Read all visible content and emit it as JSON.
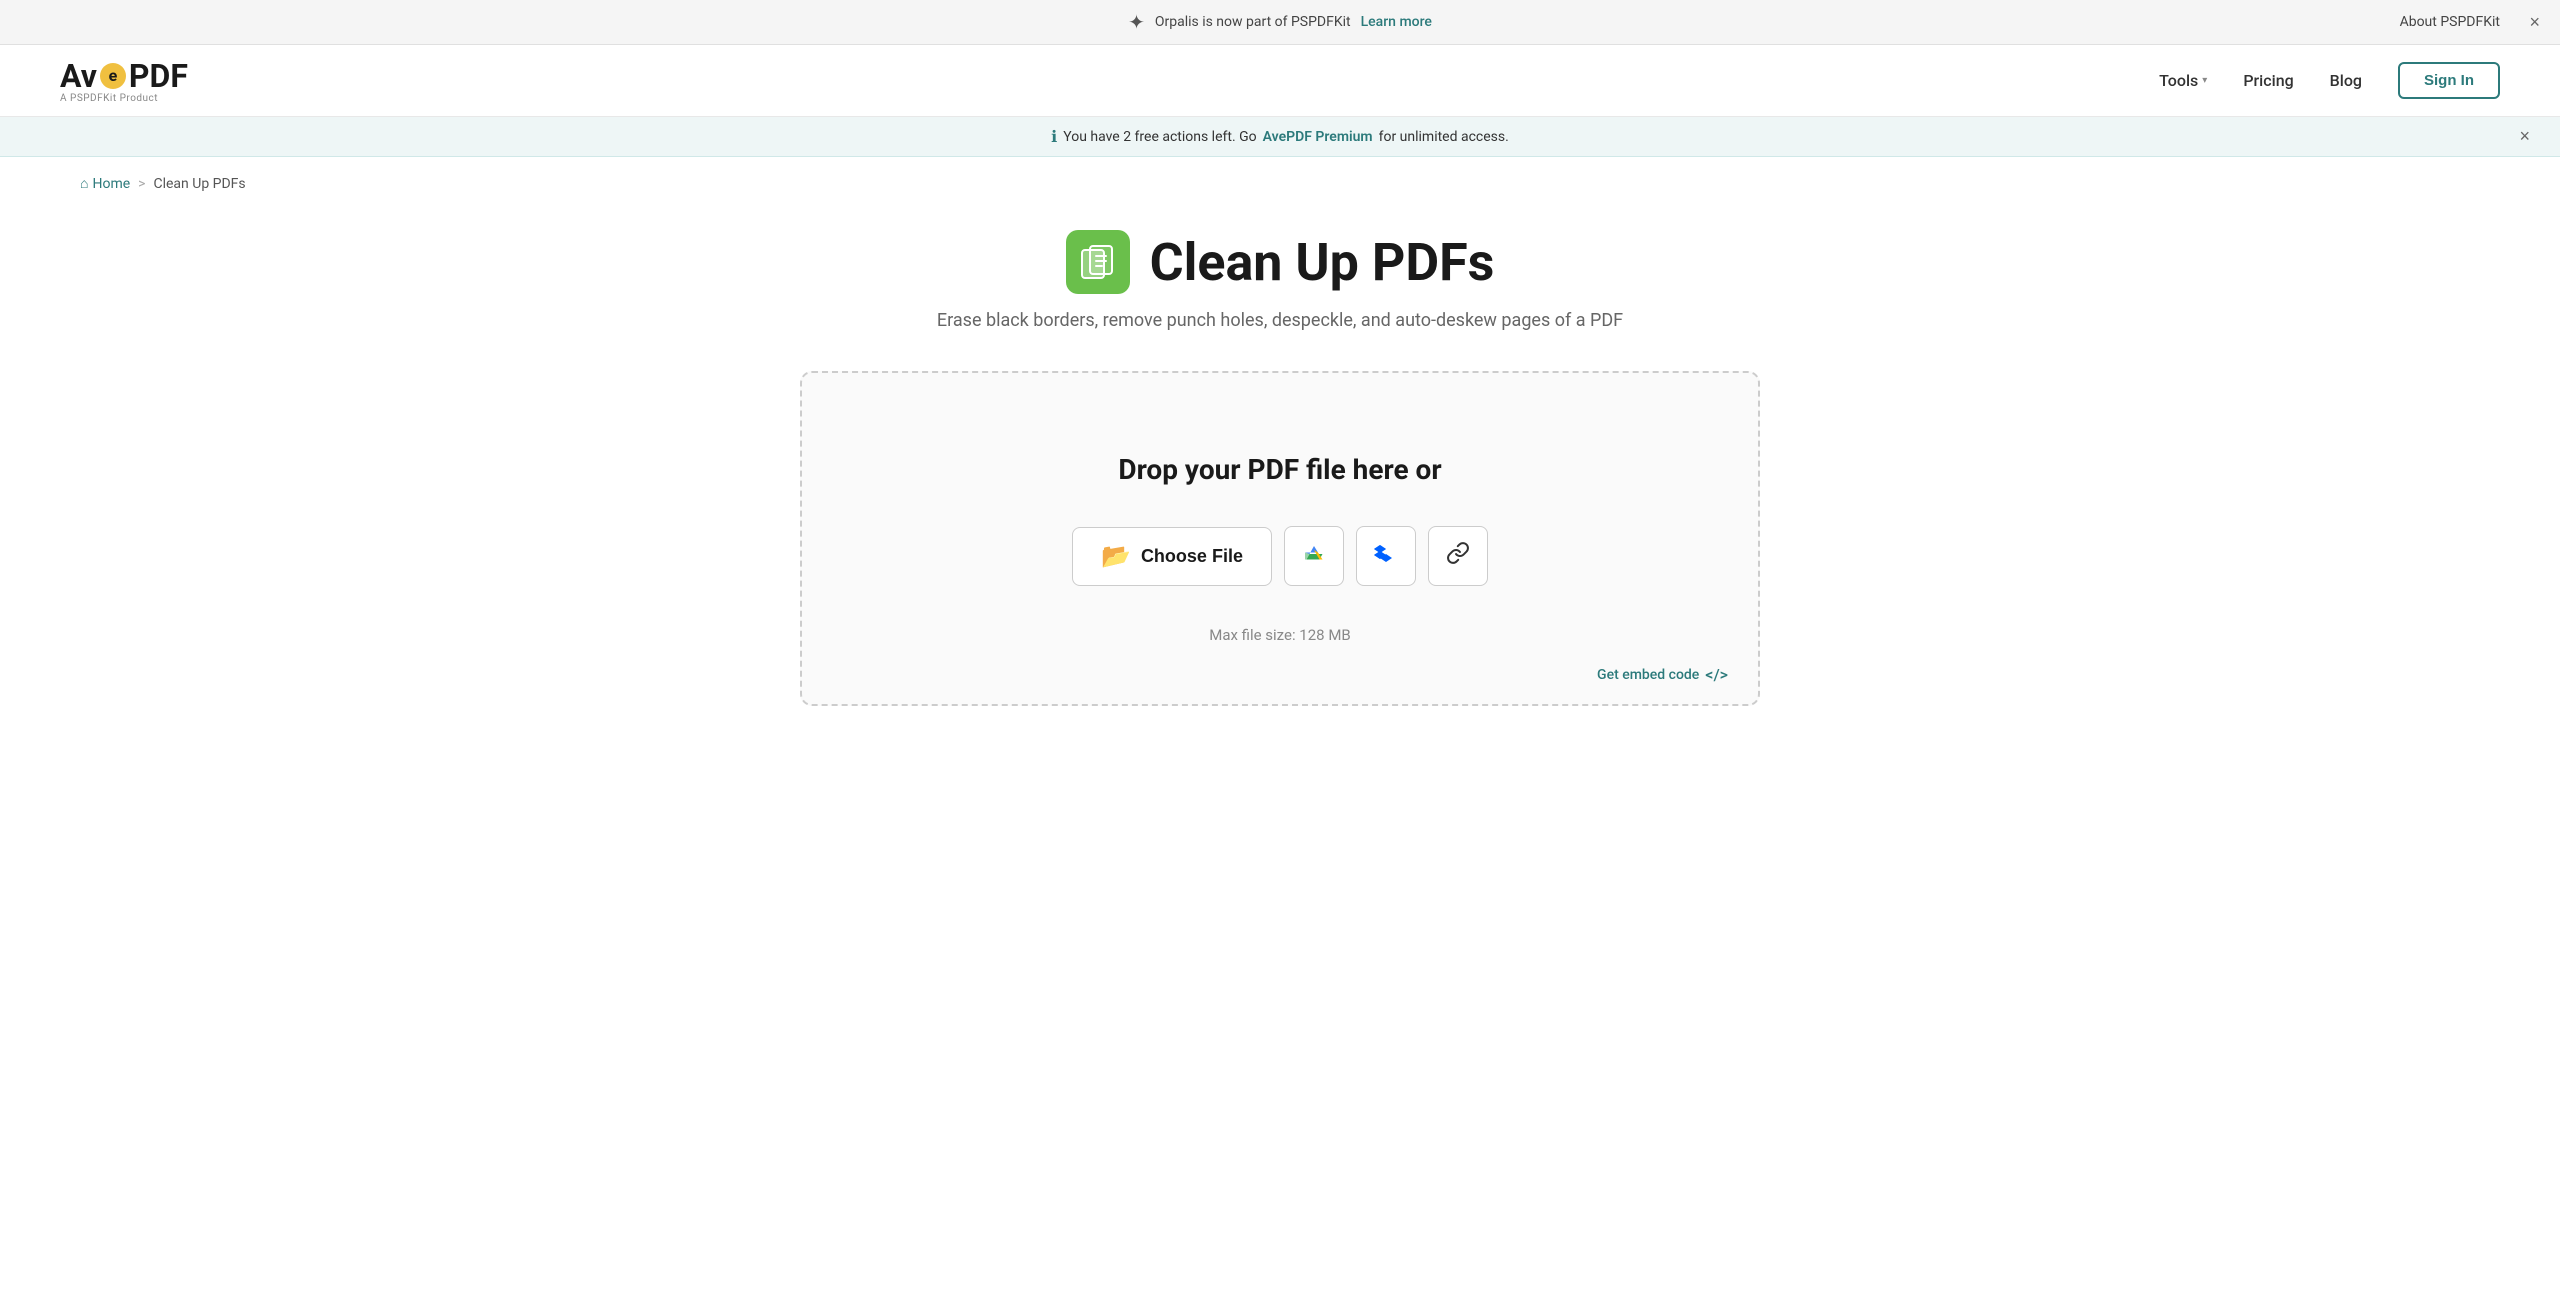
{
  "announcement": {
    "icon": "✦",
    "text": "Orpalis is now part of PSPDFKit",
    "learn_more_label": "Learn more",
    "about_label": "About PSPDFKit",
    "close_label": "×"
  },
  "navbar": {
    "logo": {
      "av": "Av",
      "e": "e",
      "pdf": "PDF",
      "sub": "A PSPDFKit Product"
    },
    "tools_label": "Tools",
    "pricing_label": "Pricing",
    "blog_label": "Blog",
    "signin_label": "Sign In"
  },
  "info_bar": {
    "icon": "ℹ",
    "message_before": "You have 2 free actions left. Go",
    "link_text": "AvePDF Premium",
    "message_after": "for unlimited access.",
    "close_label": "×"
  },
  "breadcrumb": {
    "home_label": "Home",
    "home_icon": "⌂",
    "separator": ">",
    "current": "Clean Up PDFs"
  },
  "page": {
    "icon": "📋",
    "title": "Clean Up PDFs",
    "subtitle": "Erase black borders, remove punch holes, despeckle, and auto-deskew pages of a PDF"
  },
  "dropzone": {
    "drop_text": "Drop your PDF file here or",
    "choose_file_label": "Choose File",
    "folder_icon": "📂",
    "gdrive_tooltip": "Google Drive",
    "dropbox_tooltip": "Dropbox",
    "link_tooltip": "URL",
    "max_file_size": "Max file size: 128 MB",
    "embed_label": "Get embed code",
    "embed_icon": "</>"
  }
}
